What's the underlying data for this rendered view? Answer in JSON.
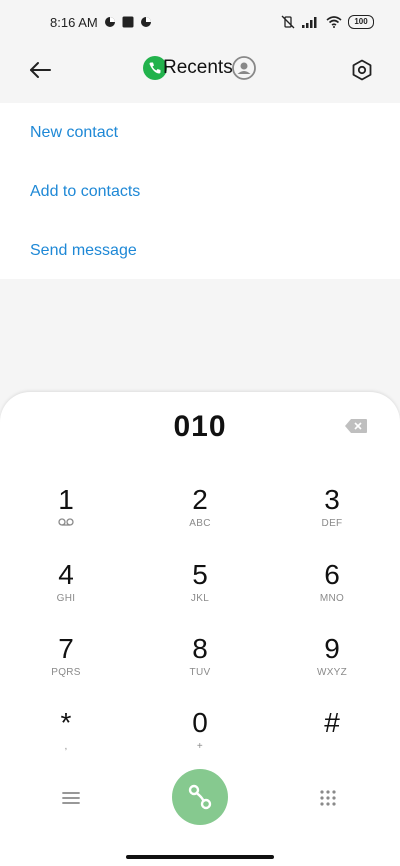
{
  "status_bar": {
    "time": "8:16 AM",
    "battery": "100",
    "left_icons": [
      "data-saver-icon",
      "square-notification-icon",
      "data-saver-icon"
    ],
    "right_icons": [
      "vibrate-off-icon",
      "signal-icon",
      "wifi-icon",
      "battery-icon"
    ]
  },
  "header": {
    "title": "Recents",
    "back_icon": "arrow-left-icon",
    "settings_icon": "settings-hexagon-icon",
    "phone_badge_icon": "phone-icon",
    "contact_icon": "contact-icon"
  },
  "actions": [
    {
      "label": "New contact"
    },
    {
      "label": "Add to contacts"
    },
    {
      "label": "Send message"
    }
  ],
  "dialpad": {
    "number": "010",
    "keys": [
      {
        "digit": "1",
        "letters": "voicemail-icon"
      },
      {
        "digit": "2",
        "letters": "ABC"
      },
      {
        "digit": "3",
        "letters": "DEF"
      },
      {
        "digit": "4",
        "letters": "GHI"
      },
      {
        "digit": "5",
        "letters": "JKL"
      },
      {
        "digit": "6",
        "letters": "MNO"
      },
      {
        "digit": "7",
        "letters": "PQRS"
      },
      {
        "digit": "8",
        "letters": "TUV"
      },
      {
        "digit": "9",
        "letters": "WXYZ"
      },
      {
        "digit": "*",
        "letters": ","
      },
      {
        "digit": "0",
        "letters": "+"
      },
      {
        "digit": "#",
        "letters": ""
      }
    ]
  },
  "colors": {
    "accent": "#1e88d6",
    "call_button": "#86c98f",
    "phone_badge": "#22b24c"
  }
}
